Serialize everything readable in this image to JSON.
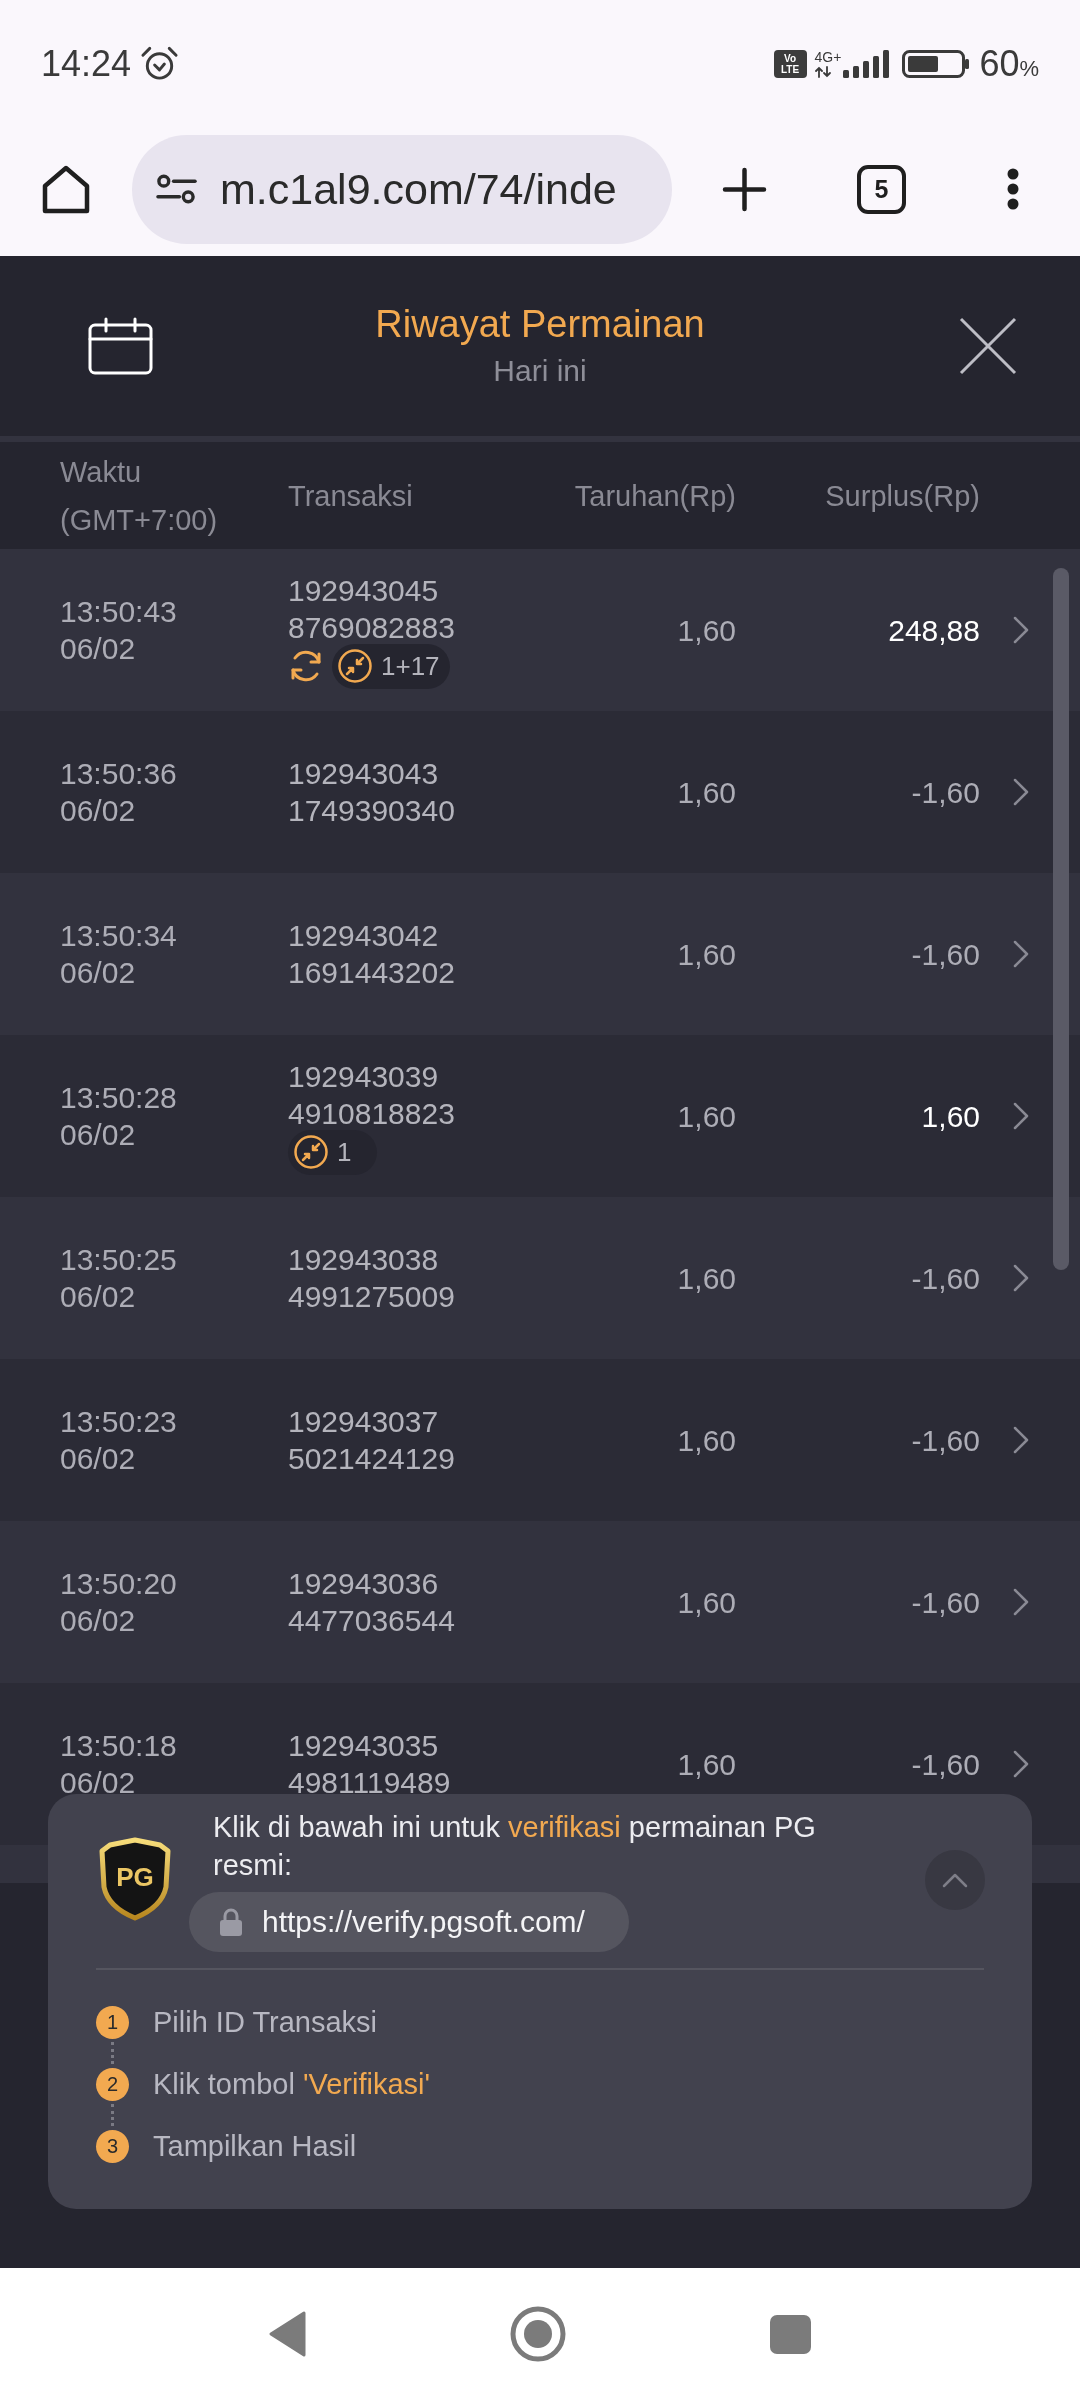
{
  "status_bar": {
    "time": "14:24",
    "network_badge": [
      "Vo",
      "LTE"
    ],
    "network_type": "4G+",
    "battery": {
      "percent": "60",
      "unit": "%"
    }
  },
  "browser_bar": {
    "url": "m.c1al9.com/74/inde",
    "tab_count": "5"
  },
  "header": {
    "title": "Riwayat Permainan",
    "subtitle": "Hari ini"
  },
  "table": {
    "columns": [
      "Waktu (GMT+7:00)",
      "Transaksi",
      "Taruhan(Rp)",
      "Surplus(Rp)"
    ],
    "rows": [
      {
        "time": "13:50:43",
        "date": "06/02",
        "transaction": [
          "192943045",
          "8769082883"
        ],
        "tags": [
          {
            "kind": "refresh"
          },
          {
            "kind": "count",
            "text": "1+17"
          }
        ],
        "bet": "1,60",
        "surplus": "248,88",
        "win": true
      },
      {
        "time": "13:50:36",
        "date": "06/02",
        "transaction": [
          "192943043",
          "1749390340"
        ],
        "bet": "1,60",
        "surplus": "-1,60",
        "win": false
      },
      {
        "time": "13:50:34",
        "date": "06/02",
        "transaction": [
          "192943042",
          "1691443202"
        ],
        "bet": "1,60",
        "surplus": "-1,60",
        "win": false
      },
      {
        "time": "13:50:28",
        "date": "06/02",
        "transaction": [
          "192943039",
          "4910818823"
        ],
        "tags": [
          {
            "kind": "count",
            "text": "1"
          }
        ],
        "bet": "1,60",
        "surplus": "1,60",
        "win": true
      },
      {
        "time": "13:50:25",
        "date": "06/02",
        "transaction": [
          "192943038",
          "4991275009"
        ],
        "bet": "1,60",
        "surplus": "-1,60",
        "win": false
      },
      {
        "time": "13:50:23",
        "date": "06/02",
        "transaction": [
          "192943037",
          "5021424129"
        ],
        "bet": "1,60",
        "surplus": "-1,60",
        "win": false
      },
      {
        "time": "13:50:20",
        "date": "06/02",
        "transaction": [
          "192943036",
          "4477036544"
        ],
        "bet": "1,60",
        "surplus": "-1,60",
        "win": false
      },
      {
        "time": "13:50:18",
        "date": "06/02",
        "transaction": [
          "192943035",
          "4981119489"
        ],
        "bet": "1,60",
        "surplus": "-1,60",
        "win": false
      }
    ]
  },
  "verify_panel": {
    "logo": "PG",
    "message": [
      {
        "text": "Klik di bawah ini untuk ",
        "highlight": false
      },
      {
        "text": "verifikasi",
        "highlight": true
      },
      {
        "text": " permainan PG resmi:",
        "highlight": false
      }
    ],
    "url": "https://verify.pgsoft.com/",
    "steps": [
      {
        "number": "1",
        "segments": [
          {
            "text": "Pilih ID Transaksi",
            "highlight": false
          }
        ]
      },
      {
        "number": "2",
        "segments": [
          {
            "text": "Klik tombol ",
            "highlight": false
          },
          {
            "text": "'Verifikasi'",
            "highlight": true
          }
        ]
      },
      {
        "number": "3",
        "segments": [
          {
            "text": "Tampilkan Hasil",
            "highlight": false
          }
        ]
      }
    ]
  }
}
